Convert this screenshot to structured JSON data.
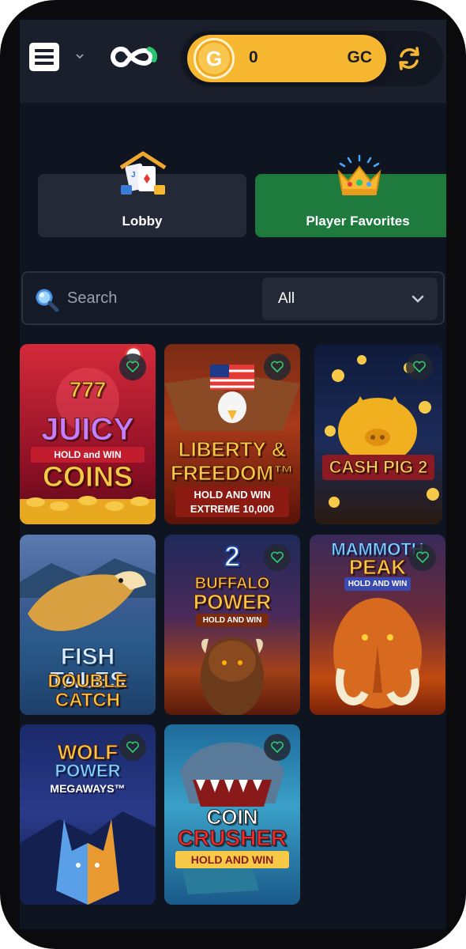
{
  "header": {
    "balance": {
      "value": "0",
      "unit": "GC",
      "coin_symbol": "G"
    }
  },
  "tabs": [
    {
      "label": "Lobby",
      "icon": "lobby-house-cards-icon"
    },
    {
      "label": "Player Favorites",
      "icon": "crown-icon",
      "active": true
    }
  ],
  "search": {
    "placeholder": "Search",
    "value": ""
  },
  "filter": {
    "selected": "All"
  },
  "games": [
    {
      "title_top": "JUICY",
      "banner": "HOLD and WIN",
      "title_bottom": "COINS",
      "badge": "777"
    },
    {
      "title_top": "LIBERTY &",
      "title_mid": "FREEDOM™",
      "banner": "HOLD AND WIN",
      "banner2": "EXTREME 10,000"
    },
    {
      "title_top": "CASH PIG 2"
    },
    {
      "title_top": "FISH TALES",
      "title_bottom": "DOUBLE CATCH"
    },
    {
      "badge": "2",
      "title_top": "BUFFALO",
      "title_mid": "POWER",
      "banner": "HOLD AND WIN"
    },
    {
      "title_top": "MAMMOTH",
      "title_mid": "PEAK",
      "banner": "HOLD AND WIN"
    },
    {
      "title_top": "WOLF",
      "title_mid": "POWER",
      "banner": "MEGAWAYS™"
    },
    {
      "title_top": "COIN",
      "title_mid": "CRUSHER",
      "banner": "HOLD AND WIN"
    }
  ],
  "colors": {
    "accent_gold": "#f7b731",
    "active_tab": "#1f7a3e",
    "background": "#0e1420"
  }
}
